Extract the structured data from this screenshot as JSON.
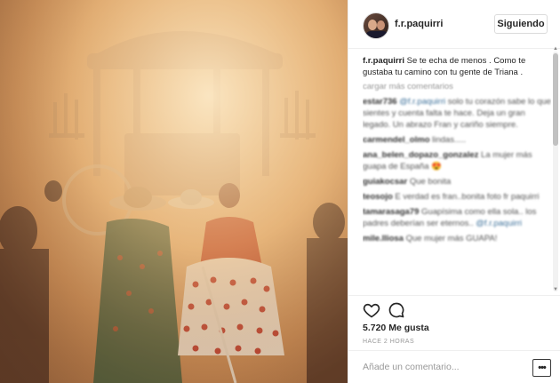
{
  "post": {
    "photo_alt_icon": "procession-photo",
    "header": {
      "username": "f.r.paquirri",
      "follow_label": "Siguiendo"
    },
    "caption": {
      "username": "f.r.paquirri",
      "text": "Se te echa de menos . Como te gustaba tu camino con tu gente de Triana ."
    },
    "load_more_label": "cargar más comentarios",
    "comments": [
      {
        "username": "estar736",
        "mention": "@f.r.paquirri",
        "text": "solo tu corazón sabe lo que sientes y cuenta falta te hace. Deja un gran legado. Un abrazo Fran y cariño siempre."
      },
      {
        "username": "carmendel_olmo",
        "mention": "",
        "text": "lindas....."
      },
      {
        "username": "ana_belen_dopazo_gonzalez",
        "mention": "",
        "text": "La mujer más guapa de España 😍"
      },
      {
        "username": "guiakocsar",
        "mention": "",
        "text": "Que bonita"
      },
      {
        "username": "teosojo",
        "mention": "",
        "text": "E verdad es fran..bonita foto fr paquirri"
      },
      {
        "username": "tamarasaga79",
        "mention": "",
        "text": "Guapísima como ella sola.. los padres deberían ser eternos.."
      },
      {
        "username": "",
        "mention": "@f.r.paquirri",
        "text": ""
      },
      {
        "username": "mile.lliosa",
        "mention": "",
        "text": "Que mujer más GUAPA!"
      }
    ],
    "actions": {
      "like_icon": "heart-icon",
      "comment_icon": "comment-bubble-icon"
    },
    "likes_text": "5.720 Me gusta",
    "time_text": "HACE 2 HORAS",
    "add_comment": {
      "placeholder": "Añade un comentario...",
      "more_label": "•••"
    },
    "colors": {
      "mention": "#3f729b",
      "border": "#efefef",
      "muted": "#999999"
    }
  }
}
